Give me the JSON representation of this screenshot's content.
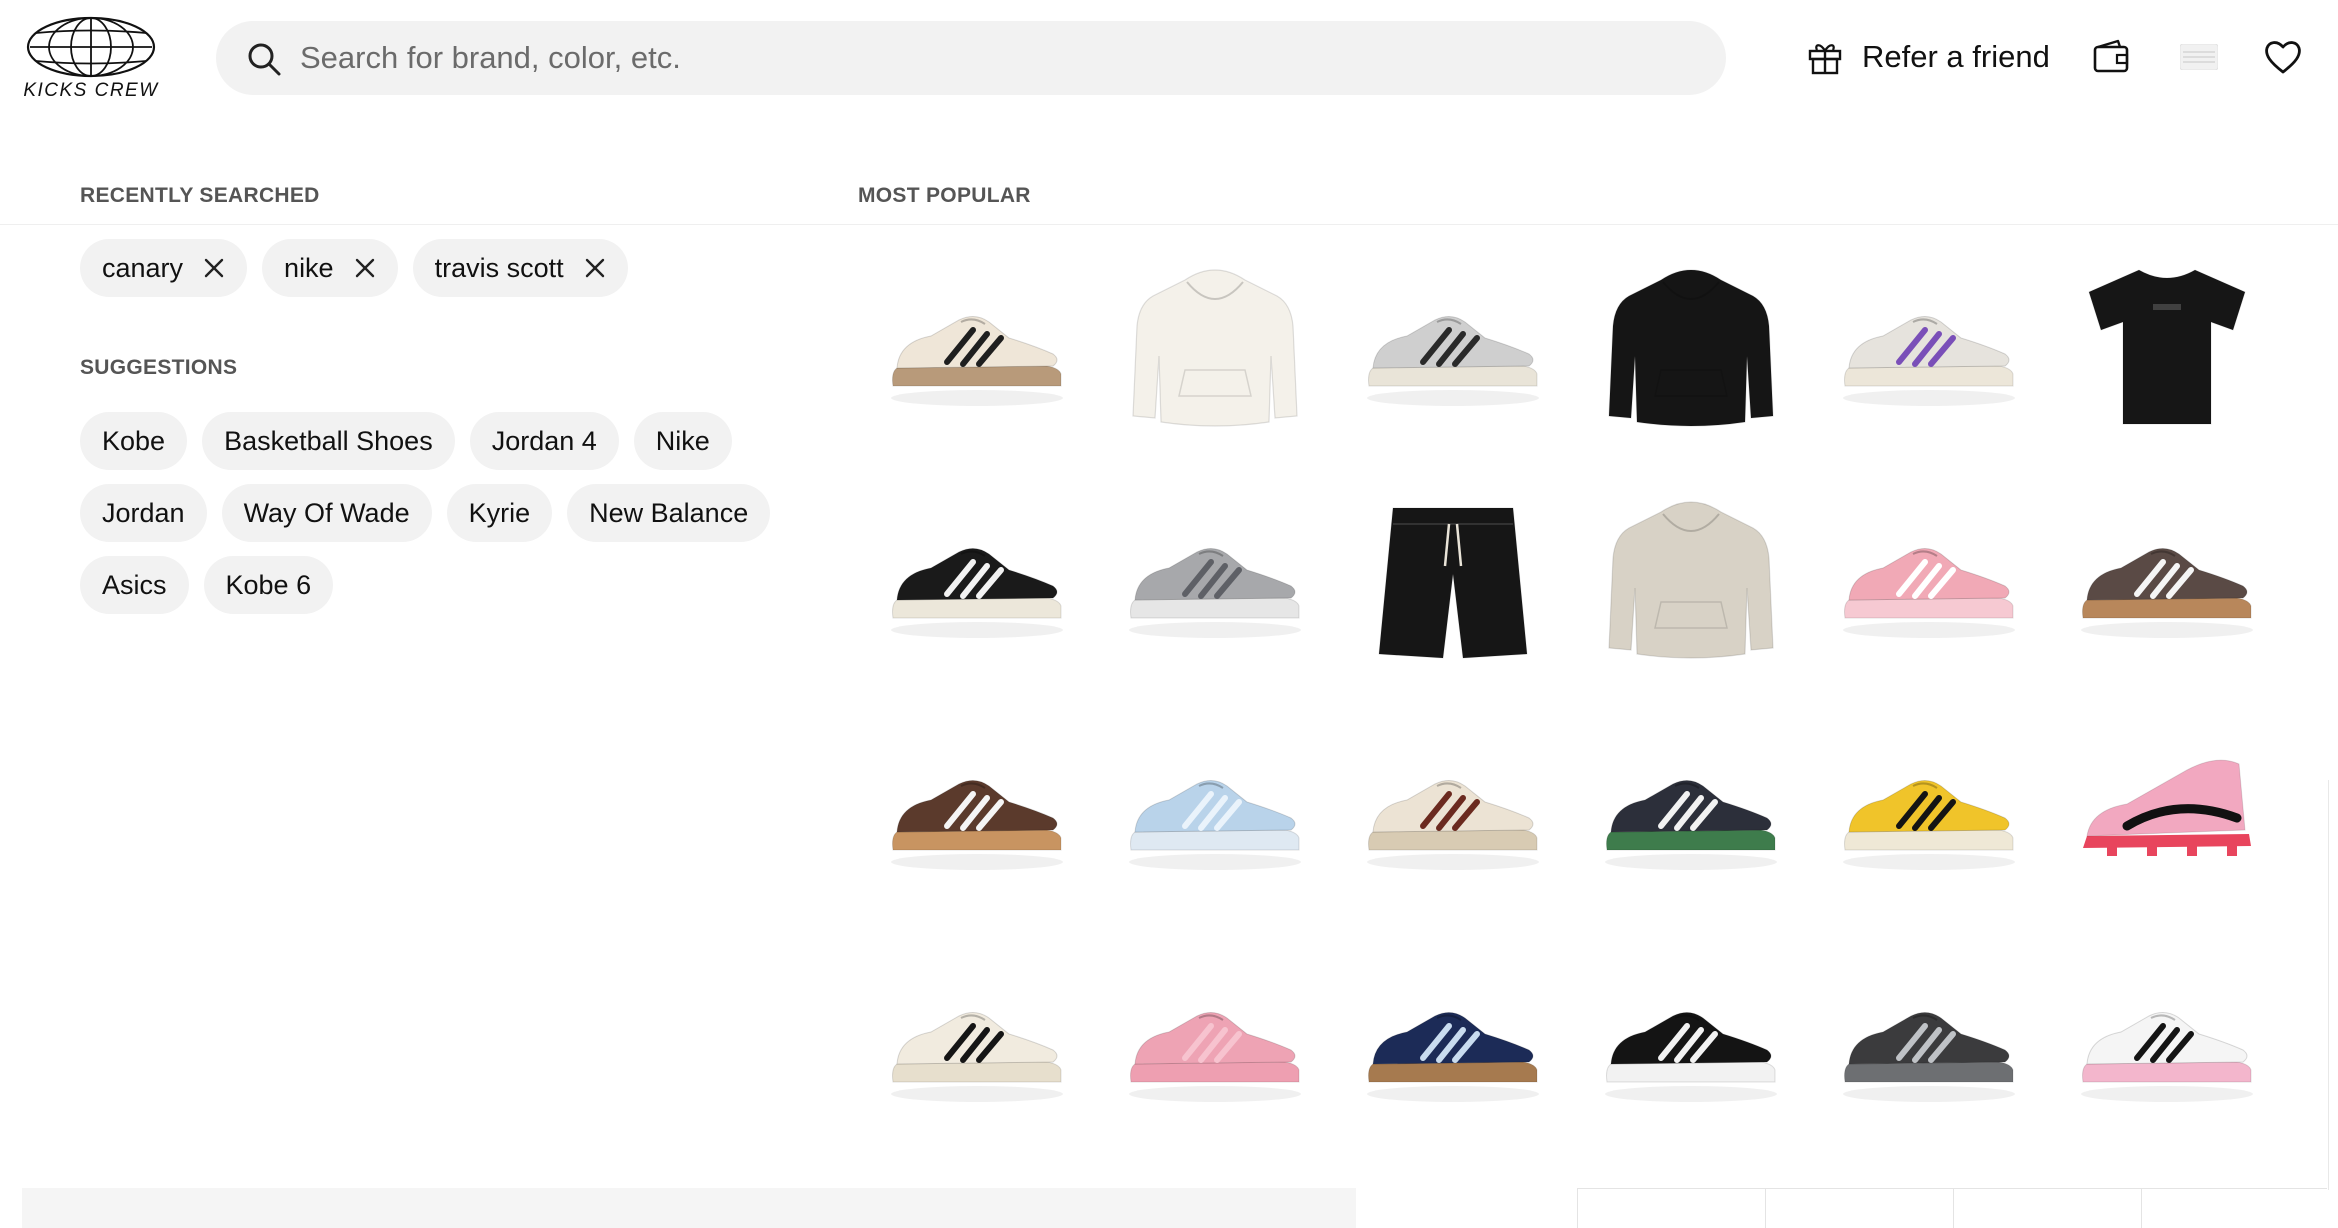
{
  "header": {
    "logo_text": "KICKS CREW",
    "search_placeholder": "Search for brand, color, etc.",
    "search_value": "",
    "refer_label": "Refer a friend",
    "icons": [
      "search-icon",
      "gift-icon",
      "wallet-icon",
      "flag-icon",
      "heart-icon"
    ]
  },
  "recent": {
    "title": "RECENTLY SEARCHED",
    "items": [
      "canary",
      "nike",
      "travis scott"
    ]
  },
  "suggestions": {
    "title": "SUGGESTIONS",
    "items": [
      "Kobe",
      "Basketball Shoes",
      "Jordan 4",
      "Nike",
      "Jordan",
      "Way Of Wade",
      "Kyrie",
      "New Balance",
      "Asics",
      "Kobe 6"
    ]
  },
  "popular": {
    "title": "MOST POPULAR",
    "products": [
      {
        "kind": "sneaker",
        "upper": "#efe6d8",
        "accent": "#1f1f1f",
        "sole": "#b89a7a"
      },
      {
        "kind": "hoodie",
        "color": "#f4f1ea"
      },
      {
        "kind": "sneaker",
        "upper": "#cfcfcf",
        "accent": "#2a2a2a",
        "sole": "#e9e4d8"
      },
      {
        "kind": "hoodie",
        "color": "#151515"
      },
      {
        "kind": "sneaker",
        "upper": "#e6e3dd",
        "accent": "#7a4fb8",
        "sole": "#ece6d9"
      },
      {
        "kind": "tshirt",
        "color": "#161616"
      },
      {
        "kind": "sneaker",
        "upper": "#1a1a1a",
        "accent": "#f2f2f2",
        "sole": "#ece7da"
      },
      {
        "kind": "sneaker",
        "upper": "#a7a8ab",
        "accent": "#5e6066",
        "sole": "#e6e6e6"
      },
      {
        "kind": "shorts",
        "color": "#161616"
      },
      {
        "kind": "hoodie",
        "color": "#d8d2c6"
      },
      {
        "kind": "sneaker",
        "upper": "#f1a9b6",
        "accent": "#ffffff",
        "sole": "#f6c9d2"
      },
      {
        "kind": "sneaker",
        "upper": "#5a4a45",
        "accent": "#f5f5f5",
        "sole": "#b8875b"
      },
      {
        "kind": "sneaker",
        "upper": "#5b3a2c",
        "accent": "#f5f5f5",
        "sole": "#c89461"
      },
      {
        "kind": "sneaker",
        "upper": "#b9d3ea",
        "accent": "#eaf3fb",
        "sole": "#dfe9f2"
      },
      {
        "kind": "sneaker",
        "upper": "#ece3d4",
        "accent": "#6b2a1f",
        "sole": "#d8cbb3"
      },
      {
        "kind": "sneaker",
        "upper": "#2c2f3a",
        "accent": "#f2f2f2",
        "sole": "#3e7c4c"
      },
      {
        "kind": "sneaker",
        "upper": "#f0c42a",
        "accent": "#141414",
        "sole": "#efe8d6"
      },
      {
        "kind": "cleat",
        "upper": "#f2a8c0",
        "accent": "#111111",
        "sole": "#e8455d"
      },
      {
        "kind": "sneaker",
        "upper": "#f1ebdf",
        "accent": "#151515",
        "sole": "#e7dfcd"
      },
      {
        "kind": "sneaker",
        "upper": "#eea3b4",
        "accent": "#f7c3cf",
        "sole": "#ee9fb1"
      },
      {
        "kind": "sneaker",
        "upper": "#1c2b57",
        "accent": "#c9dcef",
        "sole": "#a67a4f"
      },
      {
        "kind": "sneaker",
        "upper": "#141414",
        "accent": "#f2f2f2",
        "sole": "#f2f2f2"
      },
      {
        "kind": "sneaker",
        "upper": "#3b3b3d",
        "accent": "#bfc2c6",
        "sole": "#6d6f72"
      },
      {
        "kind": "sneaker",
        "upper": "#f5f5f5",
        "accent": "#151515",
        "sole": "#f3b6cc"
      }
    ]
  }
}
